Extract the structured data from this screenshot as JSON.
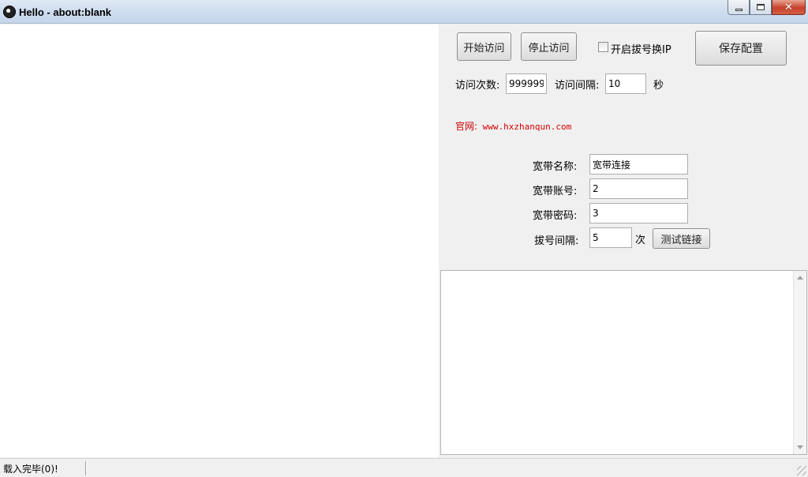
{
  "window": {
    "title": "Hello - about:blank",
    "close_symbol": "✕"
  },
  "toolbar": {
    "start_label": "开始访问",
    "stop_label": "停止访问",
    "redial_checkbox_label": "开启拔号换IP",
    "redial_checked": false,
    "save_label": "保存配置"
  },
  "visit": {
    "count_label": "访问次数:",
    "count_value": "999999",
    "interval_label": "访问间隔:",
    "interval_value": "10",
    "interval_unit": "秒"
  },
  "website": {
    "label": "官网:",
    "url": "www.hxzhanqun.com"
  },
  "broadband": {
    "name_label": "宽带名称:",
    "name_value": "宽带连接",
    "account_label": "宽带账号:",
    "account_value": "2",
    "password_label": "宽带密码:",
    "password_value": "3",
    "dial_interval_label": "拔号间隔:",
    "dial_interval_value": "5",
    "dial_interval_unit": "次",
    "test_button_label": "测试链接"
  },
  "log": {
    "content": ""
  },
  "status": {
    "text": "载入完毕(0)!"
  },
  "icons": {
    "app": "app-logo-icon",
    "minimize": "minimize-icon",
    "maximize": "maximize-icon",
    "close": "close-icon",
    "resize": "resize-grip-icon"
  }
}
